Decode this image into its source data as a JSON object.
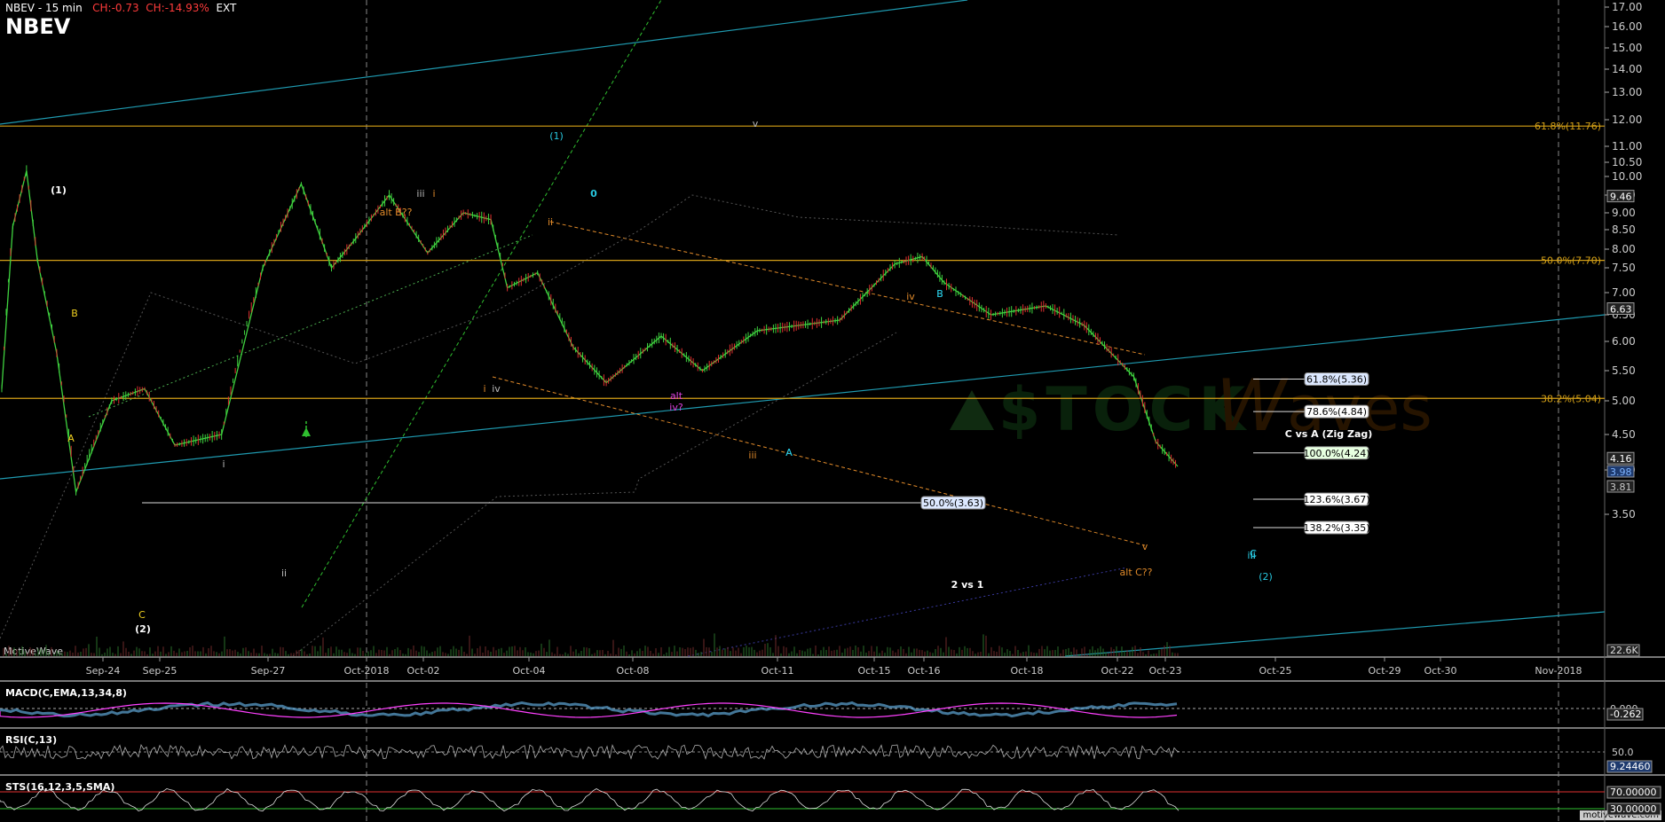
{
  "header": {
    "symbol_tf": "NBEV - 15 min",
    "change": "CH:-0.73",
    "change_pct": "CH:-14.93%",
    "session": "EXT",
    "symbol": "NBEV"
  },
  "brand": "MotiveWave",
  "watermark": "motivewave.com",
  "stockwaves_logo": "STOCKWaves",
  "colors": {
    "fib_gold": "#d4a017",
    "trend_teal": "#1f9ab0",
    "wave_orange": "#e08a2a",
    "wave_cyan": "#28c8e0",
    "wave_white": "#ffffff",
    "wave_yellow": "#f0d020",
    "up_candle": "#3fd23f",
    "down_candle": "#e03030",
    "rsi_line": "#b0b0b0",
    "macd_line": "#ff40ff",
    "macd_hist": "#5fa8d8"
  },
  "price_axis": {
    "ticks": [
      "17.00",
      "16.00",
      "15.00",
      "14.00",
      "13.00",
      "12.00",
      "11.00",
      "10.50",
      "10.00",
      "9.50",
      "9.00",
      "8.50",
      "8.00",
      "7.50",
      "7.00",
      "6.50",
      "6.00",
      "5.50",
      "5.00",
      "4.50",
      "4.00",
      "3.50"
    ],
    "tags": [
      "9.46",
      "6.63",
      "4.16",
      "3.98",
      "3.81"
    ],
    "volume_tag": "22.6K"
  },
  "time_axis": [
    "Sep-24",
    "Sep-25",
    "Sep-27",
    "Oct-2018",
    "Oct-02",
    "Oct-04",
    "Oct-08",
    "Oct-11",
    "Oct-15",
    "Oct-16",
    "Oct-18",
    "Oct-22",
    "Oct-23",
    "Oct-25",
    "Oct-29",
    "Oct-30",
    "Nov-2018"
  ],
  "fib_levels": [
    {
      "label": "61.8%(11.76)"
    },
    {
      "label": "50.0%(7.70)"
    },
    {
      "label": "38.2%(5.04)"
    }
  ],
  "projection": {
    "title": "C vs A (Zig Zag)",
    "levels": [
      "61.8%(5.36)",
      "78.6%(4.84)",
      "100.0%(4.24)",
      "123.6%(3.67)",
      "138.2%(3.35)"
    ]
  },
  "retrace": {
    "title": "2 vs 1",
    "level": "50.0%(3.63)"
  },
  "wave_labels": [
    "(1)",
    "(2)",
    "A",
    "B",
    "C",
    "(1)",
    "0",
    "v",
    "iii",
    "i",
    "alt B??",
    "ii",
    "i",
    "iv",
    "iv",
    "B",
    "alt",
    "iv?",
    "iii",
    "A",
    "v",
    "alt C??",
    "C",
    "(2)",
    "i",
    "ii",
    "iii",
    "ii",
    "B",
    "A",
    "C"
  ],
  "indicators": {
    "macd": {
      "label": "MACD(C,EMA,13,34,8)",
      "value": "-0.262",
      "ref": "0.000"
    },
    "rsi": {
      "label": "RSI(C,13)",
      "ref": "50.0",
      "value": "9.24460"
    },
    "sts": {
      "label": "STS(16,12,3,5,SMA)",
      "upper": "70.00000",
      "lower": "30.00000"
    }
  },
  "chart_data": {
    "type": "line",
    "title": "NBEV - 15 min",
    "xlabel": "",
    "ylabel": "",
    "x": [
      "Sep-24",
      "Sep-25",
      "Sep-27",
      "Oct-2018",
      "Oct-02",
      "Oct-04",
      "Oct-08",
      "Oct-11",
      "Oct-15",
      "Oct-16",
      "Oct-18",
      "Oct-22",
      "Oct-23"
    ],
    "ylim": [
      3.3,
      17.2
    ],
    "series": [
      {
        "name": "",
        "points": [
          [
            0,
            5.2
          ],
          [
            4,
            8.6
          ],
          [
            9,
            10.2
          ],
          [
            13,
            7.7
          ],
          [
            20,
            5.8
          ],
          [
            27,
            3.75
          ],
          [
            40,
            5.0
          ],
          [
            52,
            5.2
          ],
          [
            63,
            4.35
          ],
          [
            80,
            4.5
          ],
          [
            95,
            7.5
          ],
          [
            109,
            9.8
          ],
          [
            120,
            7.5
          ],
          [
            128,
            8.2
          ],
          [
            141,
            9.5
          ],
          [
            155,
            7.9
          ],
          [
            168,
            9.0
          ],
          [
            178,
            8.8
          ],
          [
            184,
            7.1
          ],
          [
            195,
            7.4
          ],
          [
            208,
            5.9
          ],
          [
            220,
            5.3
          ],
          [
            240,
            6.1
          ],
          [
            255,
            5.5
          ],
          [
            275,
            6.2
          ],
          [
            305,
            6.4
          ],
          [
            325,
            7.6
          ],
          [
            335,
            7.8
          ],
          [
            343,
            7.2
          ],
          [
            360,
            6.5
          ],
          [
            380,
            6.7
          ],
          [
            394,
            6.3
          ],
          [
            412,
            5.4
          ],
          [
            420,
            4.4
          ],
          [
            428,
            4.05
          ]
        ]
      }
    ]
  }
}
